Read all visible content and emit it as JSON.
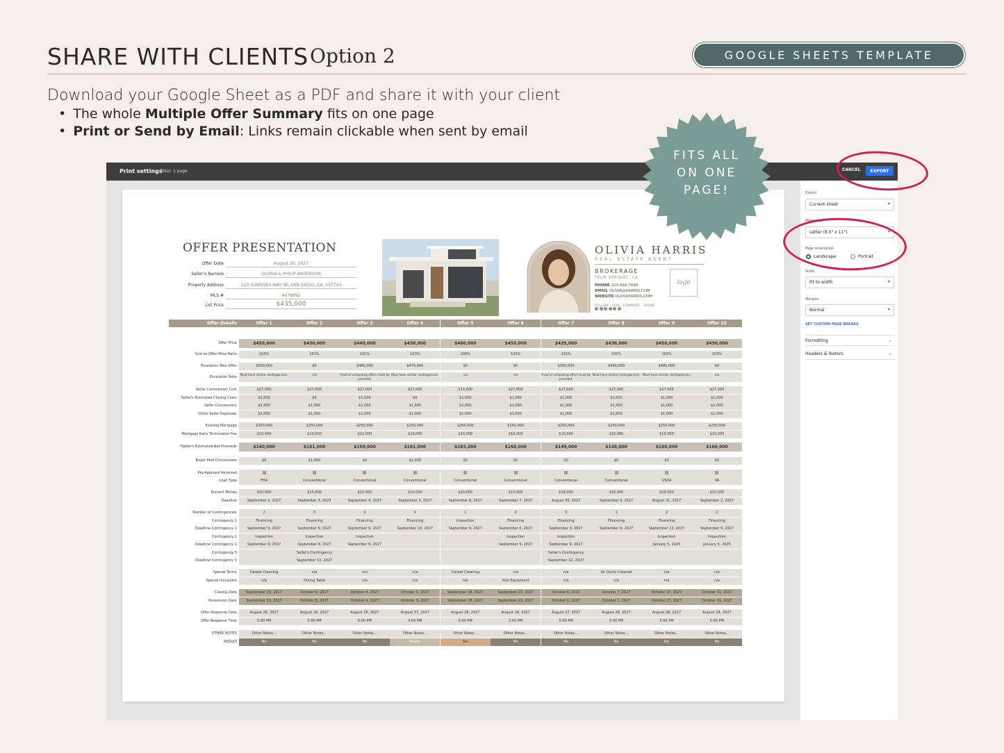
{
  "header": {
    "headline": "SHARE WITH CLIENTS",
    "option": "Option 2",
    "badge_pill": "GOOGLE SHEETS TEMPLATE",
    "intro": "Download your Google Sheet as a PDF and share it with your client",
    "bullet1_bold": "Multiple Offer Summary",
    "bullet1_pre": "The whole",
    "bullet1_post": "fits on one page",
    "bullet2_bold": "Print or Send by Email",
    "bullet2_post": ": Links remain clickable when sent by email",
    "stamp_line1": "FITS ALL",
    "stamp_line2": "ON ONE",
    "stamp_line3": "PAGE!"
  },
  "print_dialog": {
    "title": "Print settings",
    "total": "Total: 1 page",
    "cancel": "CANCEL",
    "export": "EXPORT",
    "export_label": "Export",
    "export_value": "Current sheet",
    "paper_label": "Paper size",
    "paper_value": "Letter (8.5\" x 11\")",
    "orientation_label": "Page orientation",
    "landscape": "Landscape",
    "portrait": "Portrait",
    "scale_label": "Scale",
    "scale_value": "Fit to width",
    "margins_label": "Margins",
    "margins_value": "Normal",
    "custom_breaks": "SET CUSTOM PAGE BREAKS",
    "formatting": "Formatting",
    "headers_footers": "Headers & footers",
    "accent": "#2f6fe4"
  },
  "sheet": {
    "title": "OFFER PRESENTATION",
    "fields": [
      {
        "label": "Offer Date",
        "value": "August 26, 2027"
      },
      {
        "label": "Seller's Name/s",
        "value": "GLORIA & PHILIP ANDERSON"
      },
      {
        "label": "Property Address",
        "value": "123 SUNRISES WAY SE, SAN DIEGO, CA, 197743"
      },
      {
        "label": "MLS #",
        "value": "A678892"
      },
      {
        "label": "List Price",
        "value": "$435,000"
      }
    ],
    "agent": {
      "name": "OLIVIA HARRIS",
      "role": "REAL ESTATE AGENT",
      "brokerage": "BROKERAGE",
      "location": "PALM SPRINGS, CA",
      "phone_label": "PHONE",
      "phone": "123-456-7890",
      "email_label": "EMAIL",
      "email": "OLIVIA@HARRIS.COM",
      "website_label": "WEBSITE",
      "website": "OLIVIAHARRIS.COM",
      "follow": "FOLLOW . LIKE . COMMENT . SHARE",
      "logo": "logo"
    },
    "header_label": "Offer Details",
    "offers": [
      "Offer 1",
      "Offer 2",
      "Offer 3",
      "Offer 4",
      "Offer 5",
      "Offer 6",
      "Offer 7",
      "Offer 8",
      "Offer 9",
      "Offer 10"
    ],
    "rows": [
      {
        "label": "Offer Price",
        "style": "big",
        "values": [
          "$450,000",
          "$450,000",
          "$440,000",
          "$450,000",
          "$460,000",
          "$450,000",
          "$439,000",
          "$438,000",
          "$450,000",
          "$450,000"
        ]
      },
      {
        "label": "*List-to-Offer Price Ratio",
        "style": "",
        "values": [
          "103%",
          "103%",
          "101%",
          "103%",
          "106%",
          "103%",
          "101%",
          "101%",
          "103%",
          "103%"
        ]
      },
      {
        "label": "Escalation Max Offer",
        "style": "",
        "values": [
          "$500,000",
          "$0",
          "$460,000",
          "$470,000",
          "$0",
          "$0",
          "$500,000",
          "$490,000",
          "$480,000",
          "$0"
        ]
      },
      {
        "label": "Escalation Note",
        "style": "two",
        "values": [
          "Must have similar contingencies.",
          "n/a",
          "Proof of competing offers must be provided.",
          "Must have similar contingencies.",
          "n/a",
          "n/a",
          "Proof of competing offers must be provided.",
          "Must have similar contingencies.",
          "Must have similar contingencies.",
          "n/a"
        ]
      },
      {
        "label": "Seller Commission Cost",
        "style": "",
        "values": [
          "$27,000",
          "$27,000",
          "$27,000",
          "$27,000",
          "$13,800",
          "$27,000",
          "$27,000",
          "$27,000",
          "$27,000",
          "$27,000"
        ]
      },
      {
        "label": "Seller's Estimated Closing Costs",
        "style": "",
        "values": [
          "$1,000",
          "$0",
          "$1,000",
          "$0",
          "$1,000",
          "$1,000",
          "$1,000",
          "$1,000",
          "$1,000",
          "$1,000"
        ]
      },
      {
        "label": "Seller Concessions",
        "style": "",
        "values": [
          "$1,000",
          "$1,000",
          "$1,000",
          "$1,000",
          "$1,000",
          "$1,000",
          "$1,000",
          "$1,000",
          "$1,000",
          "$1,000"
        ]
      },
      {
        "label": "Other Seller Expenses",
        "style": "",
        "values": [
          "$1,000",
          "$1,000",
          "$1,000",
          "$1,000",
          "$1,000",
          "$1,000",
          "$1,000",
          "$1,000",
          "$1,000",
          "$1,000"
        ]
      },
      {
        "label": "Existing Mortgage",
        "style": "",
        "values": [
          "$250,000",
          "$250,000",
          "$250,000",
          "$250,000",
          "$250,000",
          "$250,000",
          "$250,000",
          "$250,000",
          "$250,000",
          "$250,000"
        ]
      },
      {
        "label": "Mortgage Early Termination Fee",
        "style": "",
        "values": [
          "$10,000",
          "$10,000",
          "$10,000",
          "$10,000",
          "$10,000",
          "$10,000",
          "$10,000",
          "$10,000",
          "$10,000",
          "$10,000"
        ]
      },
      {
        "label": "*Seller's Estimated Net Proceeds",
        "style": "big",
        "values": [
          "$160,000",
          "$161,000",
          "$150,000",
          "$161,000",
          "$183,200",
          "$160,000",
          "$149,000",
          "$148,000",
          "$160,000",
          "$160,000"
        ]
      },
      {
        "label": "Buyer Paid Concessions",
        "style": "",
        "values": [
          "$0",
          "$1,000",
          "$0",
          "$1,000",
          "$0",
          "$0",
          "$0",
          "$0",
          "$0",
          "$0"
        ]
      },
      {
        "label": "Pre-Approval Received",
        "style": "check",
        "values": [
          "",
          "",
          "",
          "",
          "",
          "",
          "",
          "",
          "",
          ""
        ]
      },
      {
        "label": "Loan Type",
        "style": "",
        "values": [
          "FHA",
          "Conventional",
          "Conventional",
          "Conventional",
          "Conventional",
          "Conventional",
          "Conventional",
          "Conventional",
          "USDA",
          "VA"
        ]
      },
      {
        "label": "Earnest Money",
        "style": "",
        "values": [
          "$10,000",
          "$15,000",
          "$10,000",
          "$10,000",
          "$20,000",
          "$10,000",
          "$18,000",
          "$10,000",
          "$20,000",
          "$10,000"
        ]
      },
      {
        "label": "Deadline",
        "style": "",
        "values": [
          "September 2, 2027",
          "September 3, 2027",
          "September 4, 2027",
          "September 3, 2027",
          "September 6, 2027",
          "September 7, 2027",
          "August 30, 2027",
          "September 9, 2027",
          "August 31, 2027",
          "September 2, 2027"
        ]
      },
      {
        "label": "Number of Contingencies",
        "style": "",
        "values": [
          "2",
          "3",
          "2",
          "1",
          "1",
          "2",
          "3",
          "1",
          "2",
          "2"
        ]
      },
      {
        "label": "Contingency 1",
        "style": "",
        "values": [
          "Financing",
          "Financing",
          "Financing",
          "Financing",
          "Inspection",
          "Financing",
          "Financing",
          "Financing",
          "Financing",
          "Financing"
        ]
      },
      {
        "label": "Deadline Contingency 1",
        "style": "",
        "values": [
          "September 9, 2027",
          "September 9, 2027",
          "September 9, 2027",
          "September 10, 2027",
          "September 9, 2027",
          "September 6, 2027",
          "September 9, 2027",
          "September 9, 2027",
          "September 13, 2027",
          "September 9, 2027"
        ]
      },
      {
        "label": "Contingency 2",
        "style": "",
        "values": [
          "Inspection",
          "Inspection",
          "Inspection",
          "",
          "",
          "Inspection",
          "Inspection",
          "",
          "Inspection",
          "Inspection"
        ]
      },
      {
        "label": "Deadline Contingency 2",
        "style": "",
        "values": [
          "September 9, 2027",
          "September 9, 2027",
          "September 9, 2027",
          "",
          "",
          "September 9, 2027",
          "September 9, 2027",
          "",
          "January 5, 2025",
          "January 5, 2025"
        ]
      },
      {
        "label": "Contingency 3",
        "style": "",
        "values": [
          "",
          "Seller's Contingency",
          "",
          "",
          "",
          "",
          "Seller's Contingency",
          "",
          "",
          ""
        ]
      },
      {
        "label": "Deadline Contingency 3",
        "style": "",
        "values": [
          "",
          "September 13, 2027",
          "",
          "",
          "",
          "",
          "September 10, 2027",
          "",
          "",
          ""
        ]
      },
      {
        "label": "Special Terms",
        "style": "",
        "values": [
          "Carpet Cleaning",
          "n/a",
          "n/a",
          "n/a",
          "Carpet Cleaning",
          "n/a",
          "n/a",
          "Air Ducts Cleaned",
          "n/a",
          "n/a"
        ]
      },
      {
        "label": "Special Inclusions",
        "style": "",
        "values": [
          "n/a",
          "Dining Table",
          "n/a",
          "n/a",
          "n/a",
          "Pool Equipment",
          "n/a",
          "n/a",
          "n/a",
          "n/a"
        ]
      },
      {
        "label": "Closing Date",
        "style": "tan",
        "values": [
          "September 30, 2027",
          "October 6, 2027",
          "October 4, 2027",
          "October 3, 2027",
          "September 28, 2027",
          "September 23, 2027",
          "October 6, 2027",
          "October 7, 2027",
          "October 27, 2027",
          "October 31, 2027"
        ]
      },
      {
        "label": "Possession Date",
        "style": "tan",
        "values": [
          "September 30, 2027",
          "October 6, 2027",
          "October 4, 2027",
          "October 3, 2027",
          "September 28, 2027",
          "September 23, 2027",
          "October 6, 2027",
          "October 7, 2027",
          "October 27, 2027",
          "October 31, 2027"
        ]
      },
      {
        "label": "Offer Response Date",
        "style": "",
        "values": [
          "August 28, 2027",
          "August 28, 2027",
          "August 28, 2027",
          "August 27, 2027",
          "August 28, 2027",
          "August 28, 2027",
          "August 27, 2027",
          "August 28, 2027",
          "August 28, 2027",
          "August 28, 2027"
        ]
      },
      {
        "label": "Offer Response Time",
        "style": "",
        "values": [
          "5:00 PM",
          "5:00 PM",
          "5:00 PM",
          "4:00 PM",
          "5:00 PM",
          "3:00 PM",
          "5:00 PM",
          "5:00 PM",
          "5:00 PM",
          "5:00 PM"
        ]
      },
      {
        "label": "OTHER NOTES",
        "style": "",
        "values": [
          "Other Notes...",
          "Other Notes...",
          "Other Notes...",
          "Other Notes...",
          "Other Notes...",
          "Other Notes...",
          "Other Notes...",
          "Other Notes...",
          "Other Notes...",
          "Other Notes..."
        ]
      },
      {
        "label": "RESULT",
        "style": "res",
        "values": [
          "No",
          "No",
          "No",
          "Maybe",
          "Yes",
          "No",
          "No",
          "No",
          "No",
          "No"
        ]
      }
    ]
  },
  "colors": {
    "pill": "#4f6a67",
    "highlight_ring": "#d0204f",
    "table_header": "#a69a8c",
    "stamp": "#7a9c94"
  }
}
